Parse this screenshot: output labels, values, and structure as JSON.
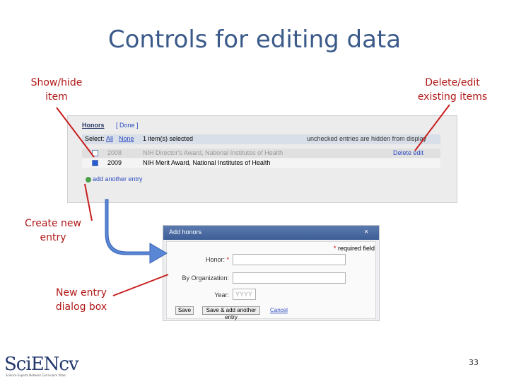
{
  "slide": {
    "title": "Controls for editing data",
    "page_number": "33"
  },
  "callouts": {
    "show_hide": "Show/hide\nitem",
    "delete_edit": "Delete/edit\nexisting items",
    "create_new": "Create new\nentry",
    "new_dialog": "New entry\ndialog box"
  },
  "honors": {
    "heading": "Honors",
    "done_link": "[ Done ]",
    "select_label": "Select:",
    "select_all": "All",
    "select_none": "None",
    "selected_count": "1 item(s) selected",
    "hidden_note": "unchecked entries are hidden from display",
    "rows": [
      {
        "year": "2008",
        "title": "NIH Director's Award, National Institutes of Health",
        "actions": "Delete  edit"
      },
      {
        "year": "2009",
        "title": "NIH Merit Award, National Institutes of Health"
      }
    ],
    "add_entry": "add another entry"
  },
  "dialog": {
    "title": "Add honors",
    "close": "×",
    "required_note": "required field",
    "fields": {
      "honor_label": "Honor:",
      "org_label": "By Organization:",
      "year_label": "Year:",
      "year_placeholder": "YYYY"
    },
    "buttons": {
      "save": "Save",
      "save_add": "Save & add another entry",
      "cancel": "Cancel"
    }
  },
  "logo": {
    "text": "SciENcv",
    "subtitle": "Science Experts Network Curriculum Vitae"
  },
  "colors": {
    "title": "#3a5a8a",
    "callout": "#b01818",
    "link": "#2a4ac0",
    "arrow": "#4a7ad0"
  }
}
